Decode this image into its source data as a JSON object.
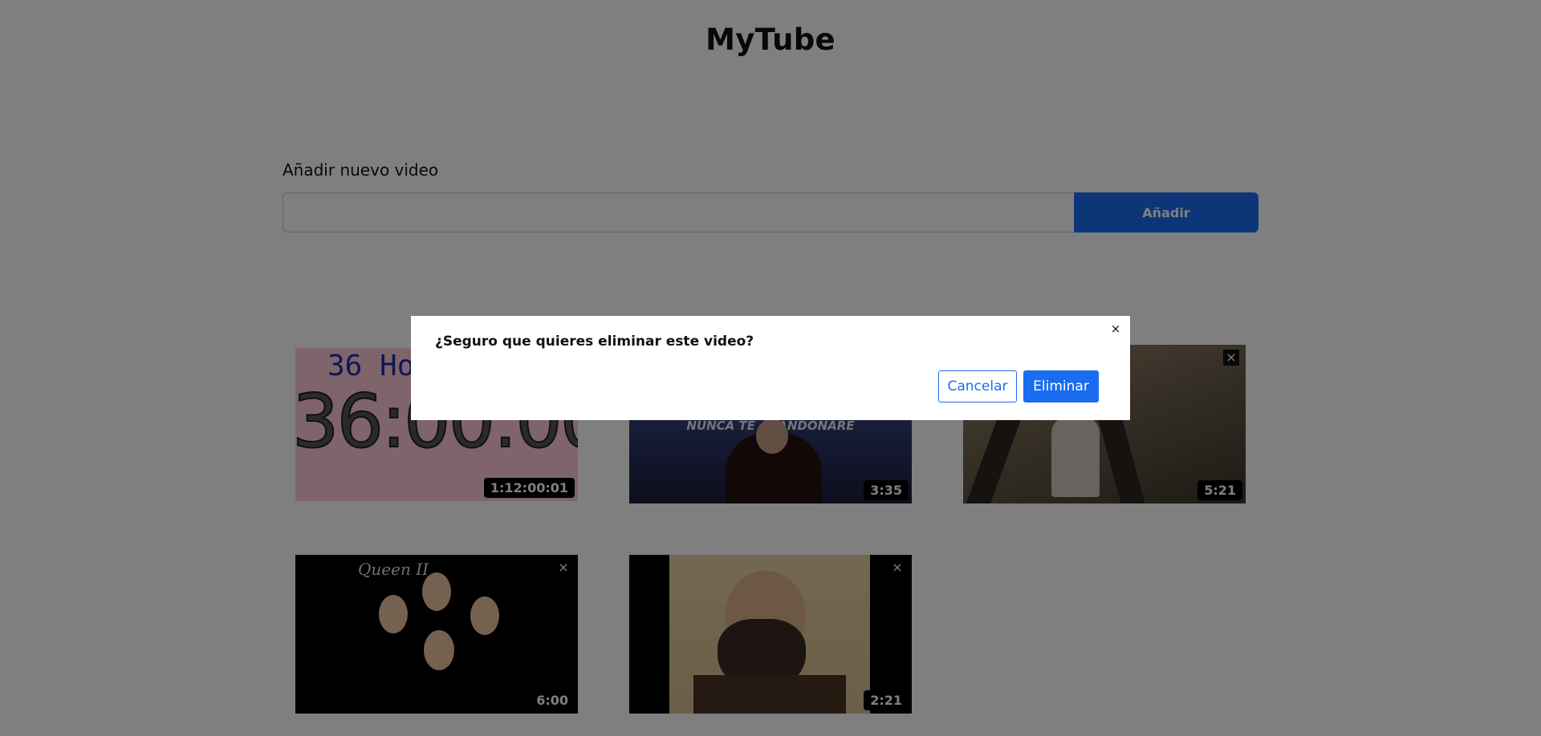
{
  "app": {
    "title": "MyTube"
  },
  "add_video": {
    "label": "Añadir nuevo video",
    "input_value": "",
    "button_label": "Añadir"
  },
  "videos": [
    {
      "duration": "1:12:00:01",
      "thumbnail_text": "36 Ho",
      "thumbnail_clock": "36:00:00"
    },
    {
      "duration": "3:35",
      "thumbnail_text": "NUNCA TE ABANDONARE"
    },
    {
      "duration": "5:21"
    },
    {
      "duration": "6:00",
      "thumbnail_text": "Queen II"
    },
    {
      "duration": "2:21"
    }
  ],
  "card_close_symbol": "×",
  "dialog": {
    "message": "¿Seguro que quieres eliminar este video?",
    "close_symbol": "×",
    "cancel_label": "Cancelar",
    "delete_label": "Eliminar"
  },
  "colors": {
    "accent": "#1a6cf0",
    "overlay": "rgba(0,0,0,0.5)"
  }
}
